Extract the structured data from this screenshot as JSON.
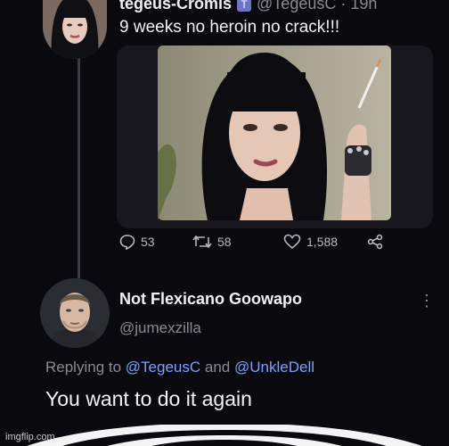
{
  "tweet": {
    "author_name": "tegeus-Cromis",
    "verified_glyph": "T",
    "handle_time": "@TegeusC · 19h",
    "text": "9 weeks no heroin no crack!!!",
    "stats": {
      "replies": "53",
      "retweets": "58",
      "likes": "1,588"
    }
  },
  "reply": {
    "author_name": "Not Flexicano Goowapo",
    "handle": "@jumexzilla",
    "replying_prefix": "Replying to",
    "mention1": "@TegeusC",
    "and_word": "and",
    "mention2": "@UnkleDell",
    "text": "You want to do it again",
    "more": "⋮"
  },
  "watermark": "imgflip.com",
  "colors": {
    "background": "#0a0a0e",
    "mention": "#7aa0ff",
    "muted": "#8a8a94"
  }
}
